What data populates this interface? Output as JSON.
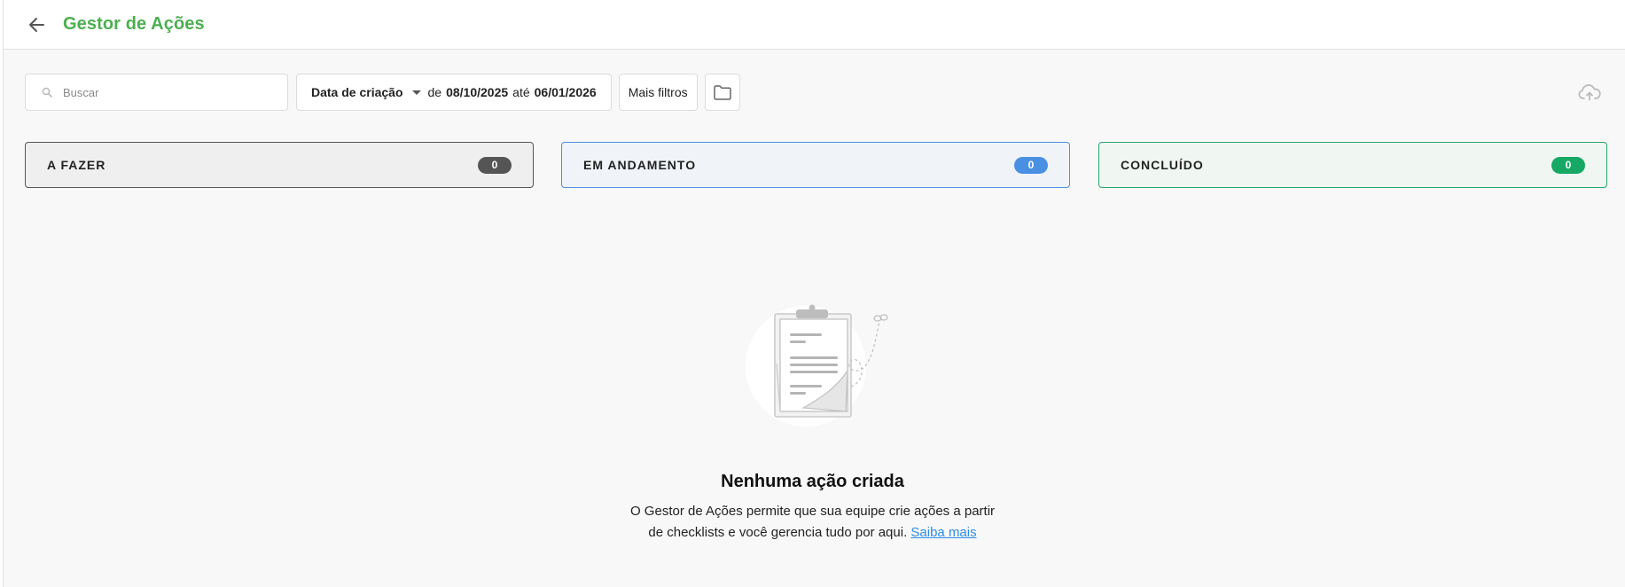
{
  "header": {
    "title": "Gestor de Ações",
    "back_icon": "arrow-left-icon"
  },
  "toolbar": {
    "search": {
      "placeholder": "Buscar",
      "value": "",
      "icon": "search-icon"
    },
    "date_filter": {
      "field_label": "Data de criação",
      "from_prefix": "de",
      "from_date": "08/10/2025",
      "to_prefix": "até",
      "to_date": "06/01/2026"
    },
    "more_filters_label": "Mais filtros",
    "folder_icon": "folder-icon",
    "export_icon": "cloud-upload-icon"
  },
  "columns": [
    {
      "label": "A FAZER",
      "count": "0",
      "color": "#555555"
    },
    {
      "label": "EM ANDAMENTO",
      "count": "0",
      "color": "#4a90e2"
    },
    {
      "label": "CONCLUÍDO",
      "count": "0",
      "color": "#16a864"
    }
  ],
  "empty_state": {
    "illustration": "clipboard-illustration",
    "title": "Nenhuma ação criada",
    "line1": "O Gestor de Ações permite que sua equipe crie ações a partir",
    "line2": "de checklists e você gerencia tudo por aqui.",
    "link_label": "Saiba mais"
  },
  "colors": {
    "brand": "#4caf50",
    "link": "#2f8be6"
  }
}
